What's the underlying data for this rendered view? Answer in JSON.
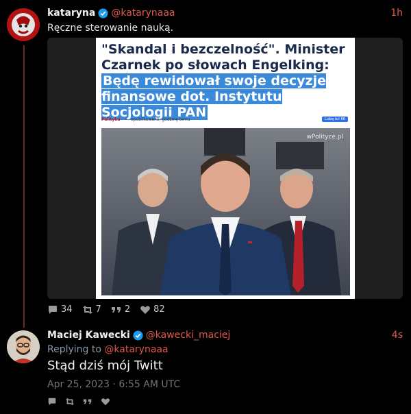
{
  "tweet1": {
    "name": "kataryna",
    "handle": "@katarynaaa",
    "time": "1h",
    "text": "Ręczne sterowanie nauką.",
    "card": {
      "headline_plain": "\"Skandal i bezczelność\". Minister Czarnek po słowach Engelking: ",
      "headline_highlight": "Będę rewidował swoje decyzje finansowe dot. Instytutu Socjologii PAN",
      "source": "Polityka",
      "published": "opublikowano: godzinę temu",
      "like_label": "Lubię to! 66",
      "watermark": "wPolityce.pl"
    },
    "stats": {
      "replies": "34",
      "retweets": "7",
      "quotes": "2",
      "likes": "82"
    }
  },
  "tweet2": {
    "name": "Maciej Kawecki",
    "handle": "@kawecki_maciej",
    "time": "4s",
    "replying_prefix": "Replying to ",
    "replying_handle": "@katarynaaa",
    "text": "Stąd dziś mój Twitt",
    "date": "Apr 25, 2023 · 6:55 AM UTC"
  },
  "colors": {
    "accent": "#e0584a",
    "background": "#000000",
    "verified": "#1d9bf0",
    "highlight": "#3b8ad9"
  },
  "icons": {
    "reply": "comment-icon",
    "retweet": "retweet-icon",
    "quote": "quote-icon",
    "like": "heart-icon",
    "verified": "verified-badge-icon"
  }
}
